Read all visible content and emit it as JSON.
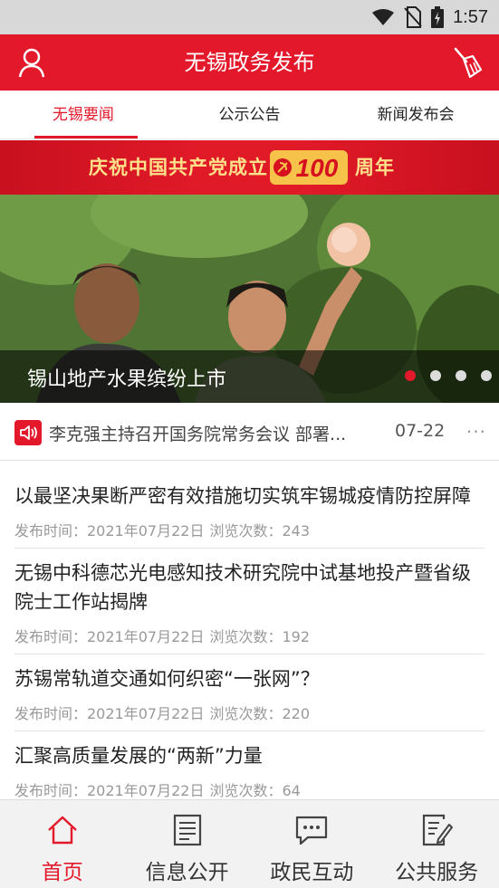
{
  "status_bar": {
    "time": "1:57"
  },
  "header": {
    "title": "无锡政务发布"
  },
  "tabs": [
    {
      "label": "无锡要闻",
      "active": true
    },
    {
      "label": "公示公告",
      "active": false
    },
    {
      "label": "新闻发布会",
      "active": false
    }
  ],
  "banner": {
    "left_text": "庆祝中国共产党成立",
    "emblem_text": "100",
    "right_text": "周年"
  },
  "carousel": {
    "caption": "锡山地产水果缤纷上市",
    "slides": 4,
    "active_slide": 1
  },
  "notice": {
    "text": "李克强主持召开国务院常务会议 部署...",
    "date": "07-22",
    "more": "···"
  },
  "news": [
    {
      "title": "以最坚决果断严密有效措施切实筑牢锡城疫情防控屏障",
      "publish": "发布时间：2021年07月22日",
      "views": "浏览次数：243"
    },
    {
      "title": "无锡中科德芯光电感知技术研究院中试基地投产暨省级院士工作站揭牌",
      "publish": "发布时间：2021年07月22日",
      "views": "浏览次数：192"
    },
    {
      "title": "苏锡常轨道交通如何织密“一张网”？",
      "publish": "发布时间：2021年07月22日",
      "views": "浏览次数：220"
    },
    {
      "title": "汇聚高质量发展的“两新”力量",
      "publish": "发布时间：2021年07月22日",
      "views": "浏览次数：64"
    }
  ],
  "bottom_nav": [
    {
      "label": "首页",
      "icon": "home-icon",
      "active": true
    },
    {
      "label": "信息公开",
      "icon": "document-icon",
      "active": false
    },
    {
      "label": "政民互动",
      "icon": "chat-icon",
      "active": false
    },
    {
      "label": "公共服务",
      "icon": "form-edit-icon",
      "active": false
    }
  ],
  "colors": {
    "brand": "#e3192b",
    "banner_text": "#ffe08a",
    "meta_text": "#999999"
  }
}
